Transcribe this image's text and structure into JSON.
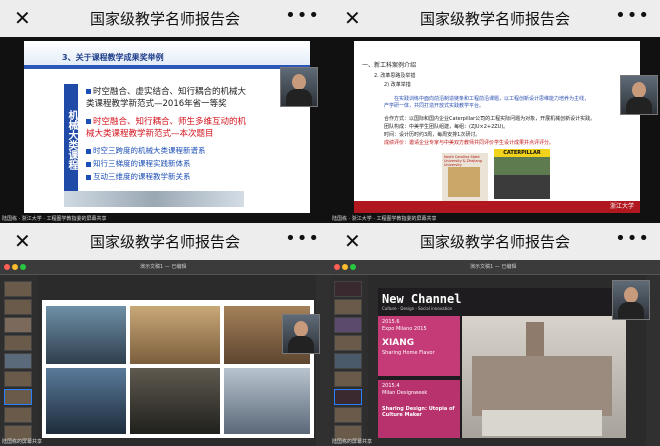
{
  "panels": [
    {
      "title": "国家级教学名师报告会",
      "footer": "陆国栋 · 浙江大学 · 工程图学教指委的屏幕共享"
    },
    {
      "title": "国家级教学名师报告会",
      "footer": "陆国栋 · 浙江大学 · 工程图学教指委的屏幕共享"
    },
    {
      "title": "国家级教学名师报告会",
      "footer": "陆国栋的屏幕共享"
    },
    {
      "title": "国家级教学名师报告会",
      "footer": "陆国栋的屏幕共享"
    }
  ],
  "icons": {
    "close": "close-icon",
    "more": "more-icon"
  },
  "slide1": {
    "heading": "3、关于课程教学成果奖举例",
    "side_label": "机械大类课程",
    "line1": "时空融合、虚实结合、知行耦合的机械大",
    "line2": "类课程教学新范式—2016年省一等奖",
    "line3": "时空融合、知行耦合、师生多维互动的机",
    "line4": "械大类课程教学新范式—本次题目",
    "bullet1": "时空三跨度的机械大类课程新谱系",
    "bullet2": "知行三梯度的课程实践新体系",
    "bullet3": "互动三维度的课程教学新关系"
  },
  "slide2": {
    "h1": "一、新工科案例介绍",
    "h2": "2. 改革思路及举措",
    "h3": "2) 改革举措",
    "p1": "在实践训练中面向前沿制造链条和工程前沿课题，以工程创新设计思维能力培养为主线，",
    "p2": "产学研一体，共同打造开放式实践教学平台。",
    "p3": "合作方式：以国际和国内企业Caterpillar公司的工程实际问题为对象，开展机械创新设计实践。",
    "p4": "团队构成：中美学生团队组建，每组：(ZJU×2+2ZU)。",
    "p5": "时间：设计历时约3周，每周安排1次研讨。",
    "p6": "成绩评价：邀请企业专家与中美双方教师共同评价学生设计成果并点评评分。",
    "poster1": "North Carolina State University & Zhejiang University",
    "poster2": "CATERPILLAR",
    "seal": "浙江大学"
  },
  "keynote": {
    "doc_title": "演示文稿1 — 已编辑"
  },
  "slide4": {
    "title": "New Channel",
    "subtitle": "Culture · Design · Social innovation",
    "year1": "2015.6",
    "event1": "Expo Milano 2015",
    "brand": "XIANG",
    "brand_sub": "Sharing Home Flavor",
    "year2": "2015.4",
    "event2": "Milan Designweek",
    "topic": "Sharing Design: Utopia of Culture Maker"
  }
}
